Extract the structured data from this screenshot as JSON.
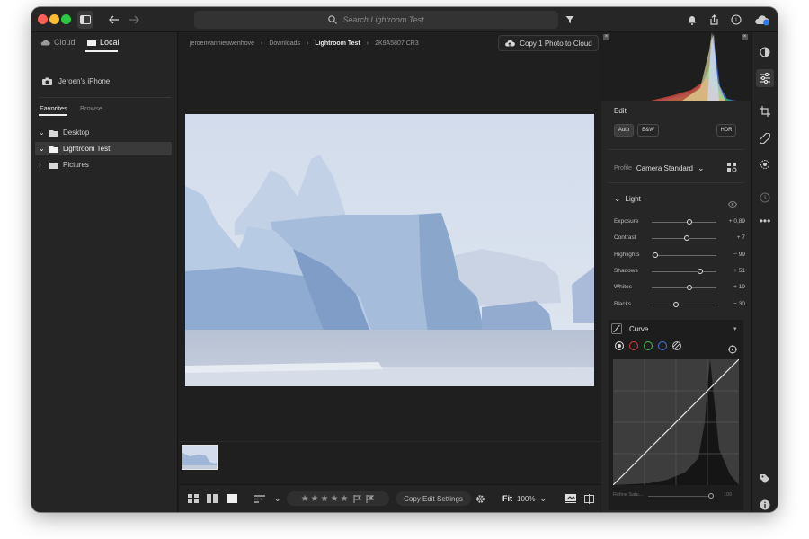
{
  "titlebar": {
    "search_placeholder": "Search Lightroom Test"
  },
  "sources": {
    "tabs": [
      {
        "label": "Cloud",
        "active": false
      },
      {
        "label": "Local",
        "active": true
      }
    ],
    "device": "Jeroen’s iPhone",
    "subtabs": [
      {
        "label": "Favorites",
        "active": true
      },
      {
        "label": "Browse",
        "active": false
      }
    ],
    "folders": [
      {
        "label": "Desktop",
        "expanded": true,
        "selected": false
      },
      {
        "label": "Lightroom Test",
        "expanded": true,
        "selected": true
      },
      {
        "label": "Pictures",
        "expanded": false,
        "selected": false
      }
    ]
  },
  "breadcrumb": [
    "jeroenvannieuwenhove",
    "Downloads",
    "Lightroom Test",
    "2K9A5807.CR3"
  ],
  "copy_button": "Copy 1 Photo to Cloud",
  "bottombar": {
    "copy_settings": "Copy Edit Settings",
    "zoom_mode": "Fit",
    "zoom_level": "100%",
    "rating_stars": 0
  },
  "edit": {
    "title": "Edit",
    "auto_label": "Auto",
    "bw_label": "B&W",
    "hdr_label": "HDR",
    "profile_label": "Profile",
    "profile_value": "Camera Standard",
    "light_title": "Light",
    "sliders": [
      {
        "label": "Exposure",
        "value": "+ 0,89",
        "pos": 0.57
      },
      {
        "label": "Contrast",
        "value": "+ 7",
        "pos": 0.53
      },
      {
        "label": "Highlights",
        "value": "− 99",
        "pos": 0.01
      },
      {
        "label": "Shadows",
        "value": "+ 51",
        "pos": 0.75
      },
      {
        "label": "Whites",
        "value": "+ 19",
        "pos": 0.58
      },
      {
        "label": "Blacks",
        "value": "− 30",
        "pos": 0.35
      }
    ],
    "curve_title": "Curve",
    "refine_label": "Refine Satu...",
    "refine_value": "100",
    "channel_colors": [
      "#d9d9d9",
      "#e03a3a",
      "#3fbf4a",
      "#3f7be0"
    ]
  }
}
